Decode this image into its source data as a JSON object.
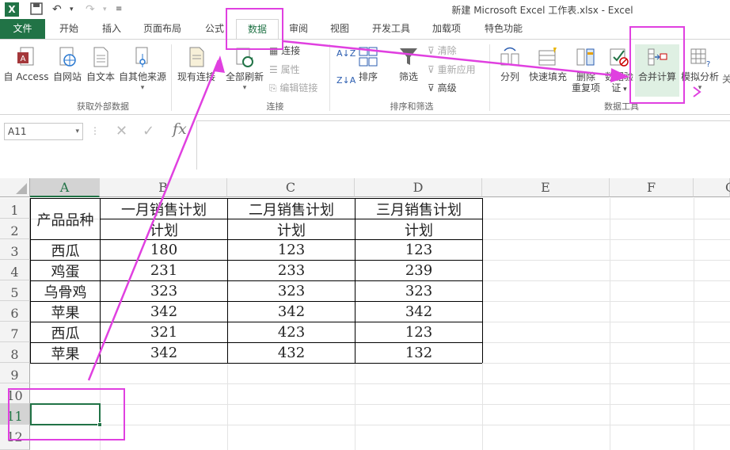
{
  "window": {
    "title": "新建 Microsoft Excel 工作表.xlsx - Excel"
  },
  "tabs": [
    "文件",
    "开始",
    "插入",
    "页面布局",
    "公式",
    "数据",
    "审阅",
    "视图",
    "开发工具",
    "加载项",
    "特色功能"
  ],
  "ribbon": {
    "get_external": {
      "group_label": "获取外部数据",
      "buttons": [
        "自 Access",
        "自网站",
        "自文本",
        "自其他来源",
        "现有连接"
      ]
    },
    "connections": {
      "group_label": "连接",
      "big_button": "全部刷新",
      "small": [
        "连接",
        "属性",
        "编辑链接"
      ]
    },
    "sort_filter": {
      "group_label": "排序和筛选",
      "sort": "排序",
      "filter": "筛选",
      "small": [
        "清除",
        "重新应用",
        "高级"
      ]
    },
    "data_tools": {
      "group_label": "数据工具",
      "buttons": [
        "分列",
        "快速填充",
        "删除\n重复项",
        "数据验\n证",
        "合并计算",
        "模拟分析"
      ],
      "btn_split": "分列",
      "btn_flash": "快速填充",
      "btn_dedupe_1": "删除",
      "btn_dedupe_2": "重复项",
      "btn_valid_1": "数据验",
      "btn_valid_2": "证",
      "btn_consolidate": "合并计算",
      "btn_whatif": "模拟分析"
    }
  },
  "formula_bar": {
    "name_box": "A11",
    "fx": "fx"
  },
  "columns": [
    "A",
    "B",
    "C",
    "D",
    "E",
    "F",
    "G"
  ],
  "rows": [
    "1",
    "2",
    "3",
    "4",
    "5",
    "6",
    "7",
    "8",
    "9",
    "10",
    "11",
    "12"
  ],
  "table": {
    "header_a": "产品品种",
    "header_b1": "一月销售计划",
    "header_c1": "二月销售计划",
    "header_d1": "三月销售计划",
    "header_b2": "计划",
    "header_c2": "计划",
    "header_d2": "计划",
    "rows": [
      [
        "西瓜",
        "180",
        "123",
        "123"
      ],
      [
        "鸡蛋",
        "231",
        "233",
        "239"
      ],
      [
        "乌骨鸡",
        "323",
        "323",
        "323"
      ],
      [
        "苹果",
        "342",
        "342",
        "342"
      ],
      [
        "西瓜",
        "321",
        "423",
        "123"
      ],
      [
        "苹果",
        "342",
        "432",
        "132"
      ]
    ]
  },
  "colors": {
    "excel_green": "#217346",
    "annotation": "#e040e0"
  }
}
